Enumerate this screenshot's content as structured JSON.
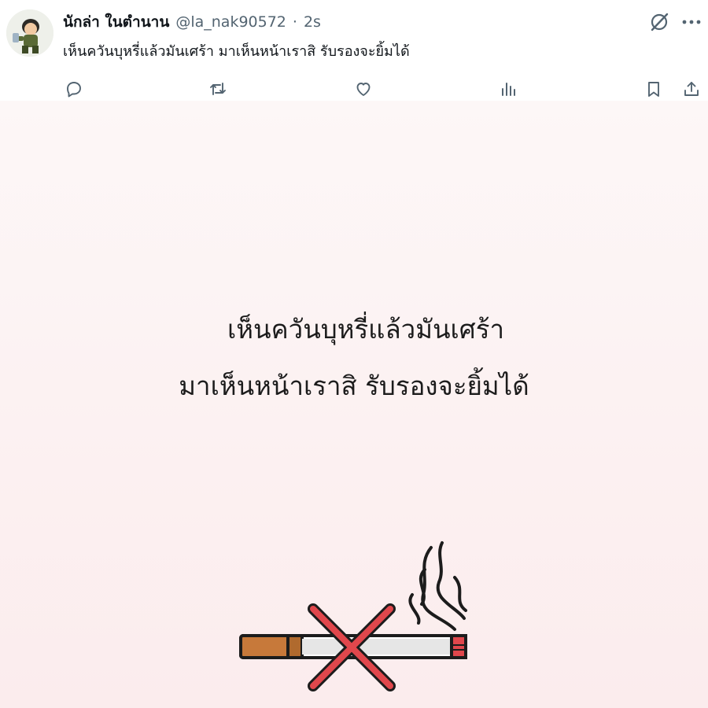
{
  "post": {
    "display_name": "นักล่า ในตำนาน",
    "handle": "@la_nak90572",
    "separator": "·",
    "time": "2s",
    "text": "เห็นควันบุหรี่แล้วมันเศร้า มาเห็นหน้าเราสิ รับรองจะยิ้มได้"
  },
  "media": {
    "line1": "เห็นควันบุหรี่แล้วมันเศร้า",
    "line2": "มาเห็นหน้าเราสิ รับรองจะยิ้มได้",
    "illustration": "no-smoking-cigarette"
  },
  "actions": [
    "reply-icon",
    "repost-icon",
    "like-icon",
    "views-icon",
    "bookmark-icon",
    "share-icon"
  ],
  "colors": {
    "icon": "#536471",
    "cross": "#e0474c",
    "filter": "#c7793a"
  }
}
